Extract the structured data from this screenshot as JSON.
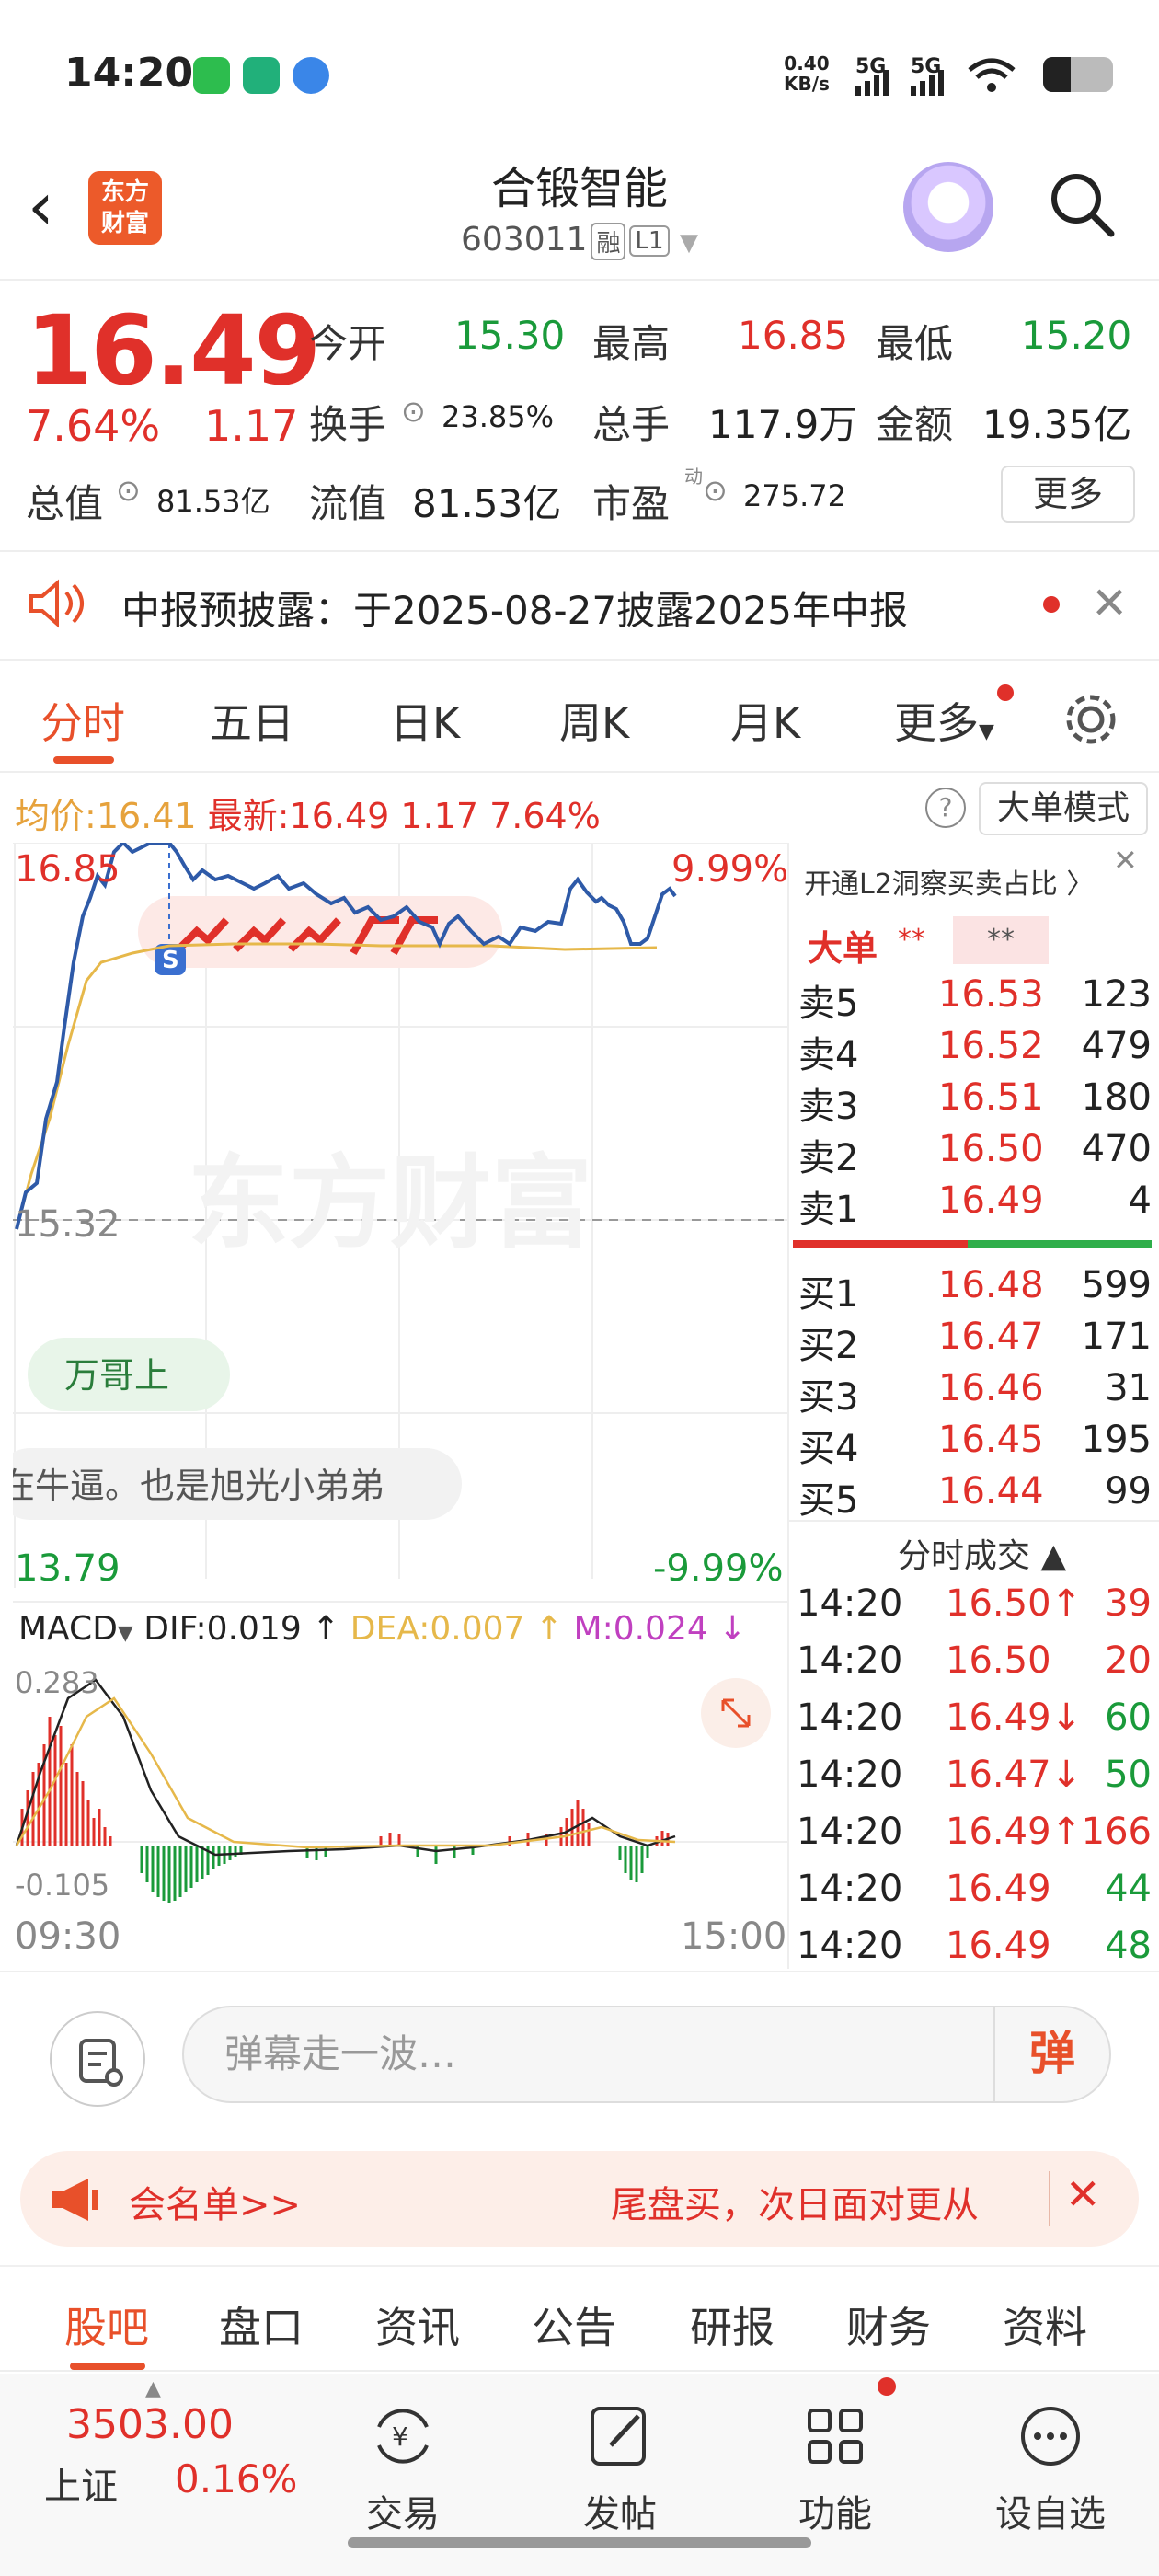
{
  "status_bar": {
    "time": "14:20",
    "net_speed": "0.40\nKB/s",
    "signal1": "5G",
    "signal2": "5G"
  },
  "header": {
    "title": "合锻智能",
    "code": "603011",
    "tag_margin": "融",
    "tag_level": "L1",
    "logo_text": "东方\n财富"
  },
  "quote": {
    "price": "16.49",
    "pct": "7.64%",
    "change": "1.17",
    "open_label": "今开",
    "open": "15.30",
    "high_label": "最高",
    "high": "16.85",
    "low_label": "最低",
    "low": "15.20",
    "turnover_label": "换手",
    "turnover": "23.85%",
    "volume_label": "总手",
    "volume": "117.9万",
    "amount_label": "金额",
    "amount": "19.35亿",
    "mcap_label": "总值",
    "mcap": "81.53亿",
    "float_label": "流值",
    "float": "81.53亿",
    "pe_label": "市盈",
    "pe_super": "动",
    "pe": "275.72",
    "more": "更多"
  },
  "notice": {
    "text": "中报预披露：于2025-08-27披露2025年中报"
  },
  "chart_tabs": [
    "分时",
    "五日",
    "日K",
    "周K",
    "月K",
    "更多"
  ],
  "intraday": {
    "avg_label": "均价:",
    "avg": "16.41",
    "latest_label": "最新:",
    "latest": "16.49",
    "chg": "1.17",
    "pct": "7.64%",
    "big_mode": "大单模式",
    "y_top": "16.85",
    "y_top_pct": "9.99%",
    "y_mid": "15.32",
    "y_bottom": "13.79",
    "y_bottom_pct": "-9.99%",
    "danmu1": "万哥上",
    "danmu2": "在牛逼。也是旭光小弟弟",
    "watermark": "东方财富",
    "macd_label": "MACD",
    "dif": "DIF:0.019 ↑",
    "dea": "DEA:0.007 ↑",
    "m": "M:0.024 ↓",
    "macd_top": "0.283",
    "macd_bottom": "-0.105",
    "time_start": "09:30",
    "time_end": "15:00"
  },
  "orderbook": {
    "l2_text": "开通L2洞察买卖占比 〉",
    "big_label": "大单",
    "big_v1": "**",
    "big_v2": "**",
    "asks": [
      {
        "label": "卖5",
        "price": "16.53",
        "vol": "123"
      },
      {
        "label": "卖4",
        "price": "16.52",
        "vol": "479"
      },
      {
        "label": "卖3",
        "price": "16.51",
        "vol": "180"
      },
      {
        "label": "卖2",
        "price": "16.50",
        "vol": "470"
      },
      {
        "label": "卖1",
        "price": "16.49",
        "vol": "4"
      }
    ],
    "bids": [
      {
        "label": "买1",
        "price": "16.48",
        "vol": "599"
      },
      {
        "label": "买2",
        "price": "16.47",
        "vol": "171"
      },
      {
        "label": "买3",
        "price": "16.46",
        "vol": "31"
      },
      {
        "label": "买4",
        "price": "16.45",
        "vol": "195"
      },
      {
        "label": "买5",
        "price": "16.44",
        "vol": "99"
      }
    ],
    "trades_title": "分时成交 ▲",
    "trades": [
      {
        "time": "14:20",
        "price": "16.50↑",
        "vol": "39"
      },
      {
        "time": "14:20",
        "price": "16.50",
        "vol": "20"
      },
      {
        "time": "14:20",
        "price": "16.49↓",
        "vol": "60"
      },
      {
        "time": "14:20",
        "price": "16.47↓",
        "vol": "50"
      },
      {
        "time": "14:20",
        "price": "16.49↑",
        "vol": "166"
      },
      {
        "time": "14:20",
        "price": "16.49",
        "vol": "44"
      },
      {
        "time": "14:20",
        "price": "16.49",
        "vol": "48"
      }
    ]
  },
  "comment": {
    "placeholder": "弹幕走一波…",
    "send": "弹"
  },
  "ad": {
    "left": "会名单>>",
    "right": "尾盘买，次日面对更从"
  },
  "sub_tabs": [
    "股吧",
    "盘口",
    "资讯",
    "公告",
    "研报",
    "财务",
    "资料"
  ],
  "bottom": {
    "index_value": "3503.00",
    "index_name": "上证",
    "index_pct": "0.16%",
    "nav": [
      "交易",
      "发帖",
      "功能",
      "设自选"
    ]
  },
  "colors": {
    "up": "#e0302a",
    "down": "#1a9a3a",
    "accent": "#e8502a",
    "price_line": "#2e5aa8",
    "avg_line": "#e6b84a"
  }
}
